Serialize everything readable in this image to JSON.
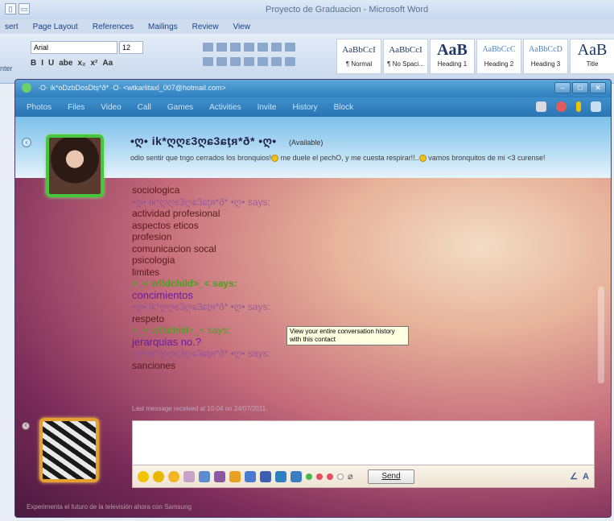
{
  "word": {
    "doc_title": "Proyecto de Graduacion - Microsoft Word",
    "tabs": [
      "sert",
      "Page Layout",
      "References",
      "Mailings",
      "Review",
      "View"
    ],
    "font_name": "Arial",
    "font_size": "12",
    "format_buttons": [
      "B",
      "I",
      "U",
      "abe",
      "x₂",
      "x²",
      "Aa"
    ],
    "clipboard_label": "nter",
    "styles": [
      {
        "preview": "AaBbCcI",
        "name": "¶ Normal"
      },
      {
        "preview": "AaBbCcI",
        "name": "¶ No Spaci..."
      },
      {
        "preview": "AaB",
        "name": "Heading 1"
      },
      {
        "preview": "AaBbCcC",
        "name": "Heading 2"
      },
      {
        "preview": "AaBbCcD",
        "name": "Heading 3"
      },
      {
        "preview": "AaB",
        "name": "Title"
      }
    ]
  },
  "msn": {
    "window_title": "·O· ik*oDzbDosDtṣ*ð* ·O· <wtkarlitaxl_007@hotmail.com>",
    "menu": [
      "Photos",
      "Files",
      "Video",
      "Call",
      "Games",
      "Activities",
      "Invite",
      "History",
      "Block"
    ],
    "contact_name": "•ღ• ik*ღღε3ღɕ3ɕţя*ð* •ღ•",
    "contact_status": "(Available)",
    "psm_1": "odio sentir que tngo cerrados los bronquios!",
    "psm_2": " me duele el pechO, y me cuesta respirar!!..",
    "psm_3": " vamos bronquitos de mi <3 curense!",
    "tooltip": "View your entire conversation history with this contact",
    "last_message": "Last message received at 10:04 on 24/07/2011.",
    "send_label": "Send",
    "ad": "Experimenta el futuro de la televisión ahora con Samsung",
    "conversation": [
      {
        "type": "msg",
        "text": "sociologica"
      },
      {
        "type": "sender",
        "text": "•ღ• ik*ღღε3ღɕ3ɕţя*ð* •ღ• says:"
      },
      {
        "type": "msg",
        "text": "actividad profesional"
      },
      {
        "type": "msg",
        "text": "aspectos eticos"
      },
      {
        "type": "msg",
        "text": "profesion"
      },
      {
        "type": "msg",
        "text": "comunicacion socal"
      },
      {
        "type": "msg",
        "text": "psicologia"
      },
      {
        "type": "msg",
        "text": "limites"
      },
      {
        "type": "sender2",
        "text": ">_< w!ldchild>_< says:"
      },
      {
        "type": "jer",
        "text": "concimientos"
      },
      {
        "type": "sender",
        "text": "•ღ• ik*ღღε3ღɕ3ɕţя*ð* •ღ• says:"
      },
      {
        "type": "msg",
        "text": "respeto"
      },
      {
        "type": "sender2",
        "text": ">_< w!ldchild>_< says:"
      },
      {
        "type": "jer",
        "text": "jerarquias no.?"
      },
      {
        "type": "sender",
        "text": "•ღ• ik*ღღε3ღɕ3ɕţя*ð* •ღ• says:"
      },
      {
        "type": "msg",
        "text": "sanciones"
      }
    ]
  }
}
